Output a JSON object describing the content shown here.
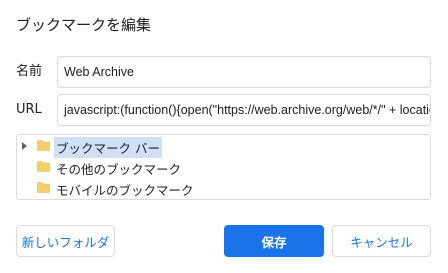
{
  "dialog": {
    "title": "ブックマークを編集"
  },
  "fields": {
    "name_label": "名前",
    "name_value": "Web Archive",
    "url_label": "URL",
    "url_value": "javascript:(function(){open(\"https://web.archive.org/web/*/\" + locatio"
  },
  "tree": {
    "items": [
      {
        "label": "ブックマーク バー",
        "selected": true,
        "expandable": true
      },
      {
        "label": "その他のブックマーク",
        "selected": false,
        "expandable": false
      },
      {
        "label": "モバイルのブックマーク",
        "selected": false,
        "expandable": false
      }
    ],
    "folder_icon": "folder-icon",
    "folder_color": "#f5d06a",
    "selection_color": "#cfe0f7"
  },
  "buttons": {
    "new_folder": "新しいフォルダ",
    "save": "保存",
    "cancel": "キャンセル"
  },
  "colors": {
    "accent": "#1a73e8",
    "border": "#dadce0",
    "text": "#202124"
  }
}
